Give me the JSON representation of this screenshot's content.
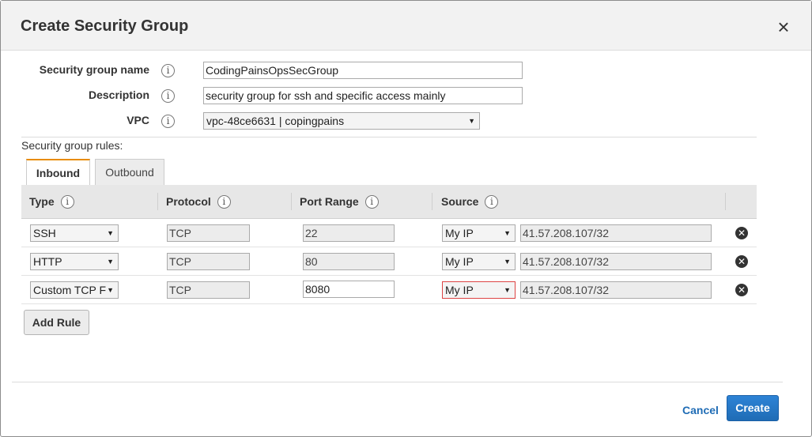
{
  "dialog": {
    "title": "Create Security Group",
    "close_symbol": "×"
  },
  "form": {
    "name_label": "Security group name",
    "name_value": "CodingPainsOpsSecGroup",
    "description_label": "Description",
    "description_value": "security group for ssh and specific access mainly",
    "vpc_label": "VPC",
    "vpc_value": "vpc-48ce6631 | copingpains",
    "info_symbol": "i"
  },
  "rules": {
    "label": "Security group rules:",
    "tabs": [
      {
        "label": "Inbound",
        "active": true
      },
      {
        "label": "Outbound",
        "active": false
      }
    ],
    "columns": [
      "Type",
      "Protocol",
      "Port Range",
      "Source"
    ],
    "rows": [
      {
        "type": "SSH",
        "protocol": "TCP",
        "port": "22",
        "source_type": "My IP",
        "source_value": "41.57.208.107/32"
      },
      {
        "type": "HTTP",
        "protocol": "TCP",
        "port": "80",
        "source_type": "My IP",
        "source_value": "41.57.208.107/32"
      },
      {
        "type": "Custom TCP F",
        "protocol": "TCP",
        "port": "8080",
        "source_type": "My IP",
        "source_value": "41.57.208.107/32"
      }
    ],
    "add_rule_label": "Add Rule"
  },
  "footer": {
    "cancel_label": "Cancel",
    "create_label": "Create"
  },
  "icons": {
    "info": "info-icon",
    "close": "close-icon",
    "remove": "remove-rule-icon",
    "dropdown": "chevron-down-icon"
  },
  "colors": {
    "primary_button": "#1f6cb5",
    "active_tab_accent": "#e88c00",
    "error_border": "#d44444"
  }
}
